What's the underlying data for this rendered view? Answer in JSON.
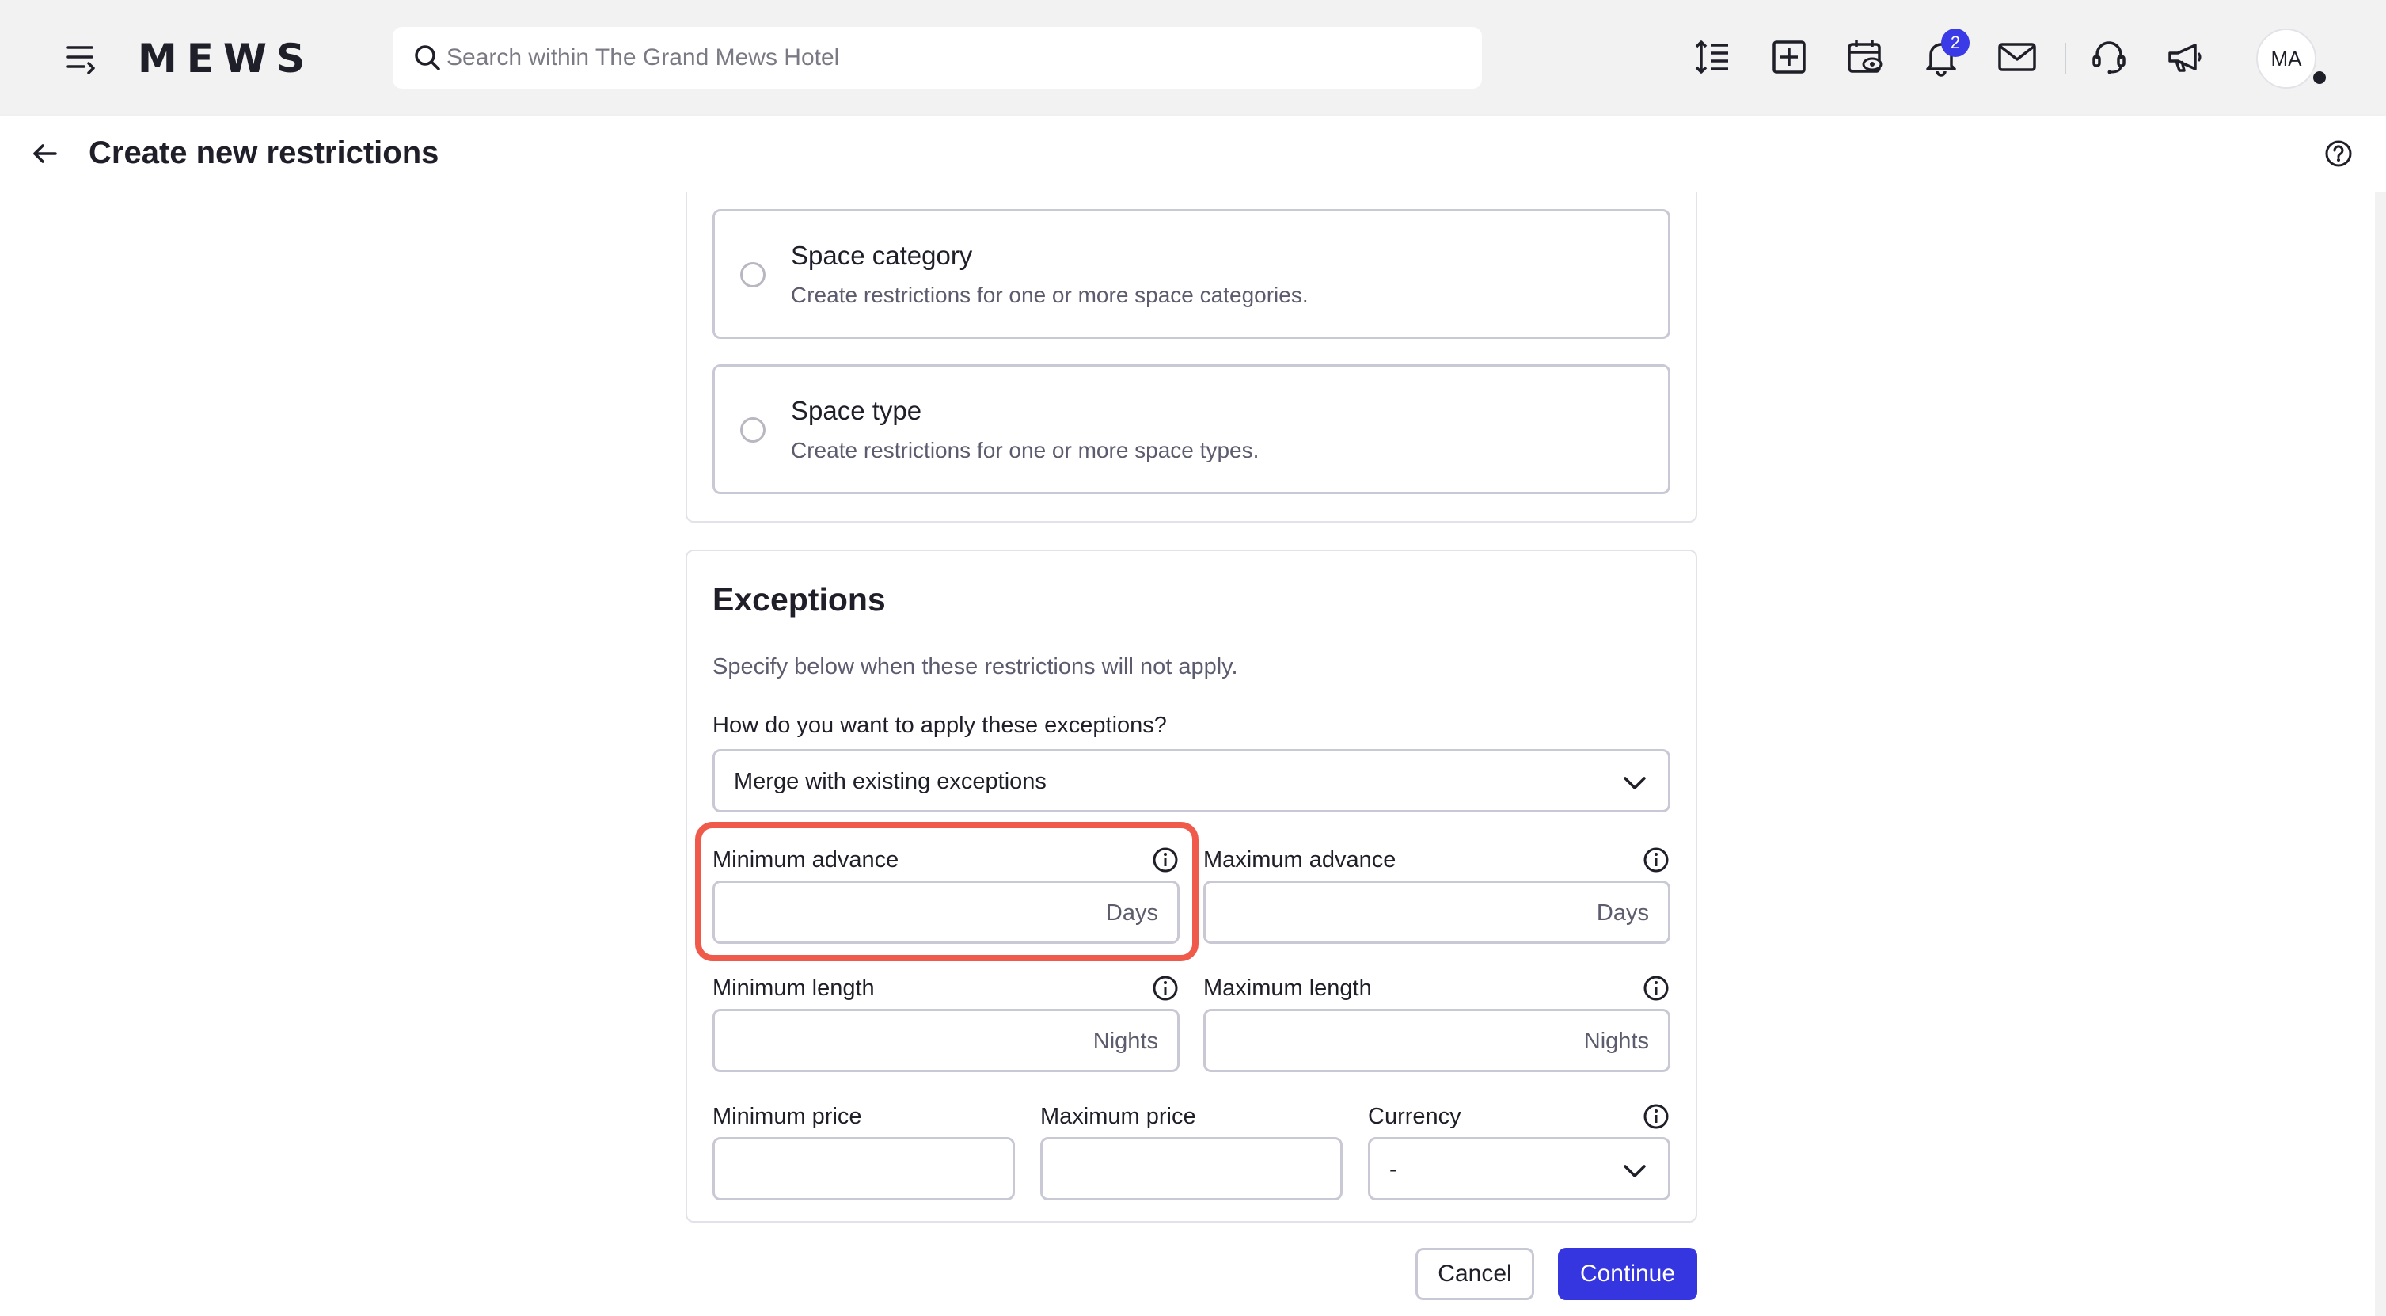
{
  "topbar": {
    "logo": "MEWS",
    "search_placeholder": "Search within The Grand Mews Hotel",
    "notification_count": "2",
    "avatar_initials": "MA",
    "icons": [
      "menu-icon",
      "search-icon",
      "line-height-icon",
      "add-icon",
      "calendar-eye-icon",
      "bell-icon",
      "mail-icon",
      "support-icon",
      "megaphone-icon"
    ]
  },
  "header": {
    "title": "Create new restrictions"
  },
  "options": [
    {
      "title": "Space category",
      "description": "Create restrictions for one or more space categories."
    },
    {
      "title": "Space type",
      "description": "Create restrictions for one or more space types."
    }
  ],
  "exceptions": {
    "title": "Exceptions",
    "description": "Specify below when these restrictions will not apply.",
    "apply_label": "How do you want to apply these exceptions?",
    "apply_value": "Merge with existing exceptions",
    "min_advance_label": "Minimum advance",
    "min_advance_suffix": "Days",
    "max_advance_label": "Maximum advance",
    "max_advance_suffix": "Days",
    "min_length_label": "Minimum length",
    "min_length_suffix": "Nights",
    "max_length_label": "Maximum length",
    "max_length_suffix": "Nights",
    "min_price_label": "Minimum price",
    "max_price_label": "Maximum price",
    "currency_label": "Currency",
    "currency_value": "-"
  },
  "actions": {
    "cancel": "Cancel",
    "continue": "Continue"
  },
  "colors": {
    "accent": "#3636e0",
    "highlight": "#f05a4a"
  }
}
